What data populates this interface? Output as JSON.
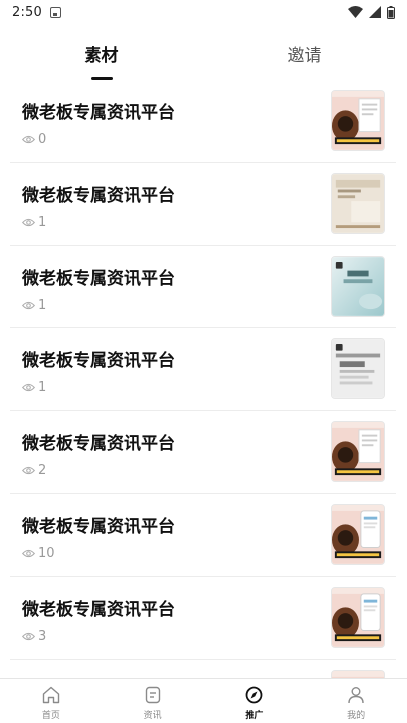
{
  "status_bar": {
    "time": "2:50"
  },
  "tabs": [
    {
      "label": "素材",
      "active": true
    },
    {
      "label": "邀请",
      "active": false
    }
  ],
  "items": [
    {
      "title": "微老板专属资讯平台",
      "views": "0",
      "thumb": "coffee"
    },
    {
      "title": "微老板专属资讯平台",
      "views": "1",
      "thumb": "beige"
    },
    {
      "title": "微老板专属资讯平台",
      "views": "1",
      "thumb": "teal"
    },
    {
      "title": "微老板专属资讯平台",
      "views": "1",
      "thumb": "gray"
    },
    {
      "title": "微老板专属资讯平台",
      "views": "2",
      "thumb": "coffee"
    },
    {
      "title": "微老板专属资讯平台",
      "views": "10",
      "thumb": "coffee-phone"
    },
    {
      "title": "微老板专属资讯平台",
      "views": "3",
      "thumb": "coffee-phone"
    },
    {
      "title": "",
      "views": "",
      "thumb": "coffee"
    }
  ],
  "nav": [
    {
      "label": "首页",
      "icon": "home-icon",
      "active": false
    },
    {
      "label": "资讯",
      "icon": "news-icon",
      "active": false
    },
    {
      "label": "推广",
      "icon": "compass-icon",
      "active": true
    },
    {
      "label": "我的",
      "icon": "person-icon",
      "active": false
    }
  ],
  "colors": {
    "accent": "#111111",
    "muted": "#999999",
    "divider": "#ececec"
  }
}
